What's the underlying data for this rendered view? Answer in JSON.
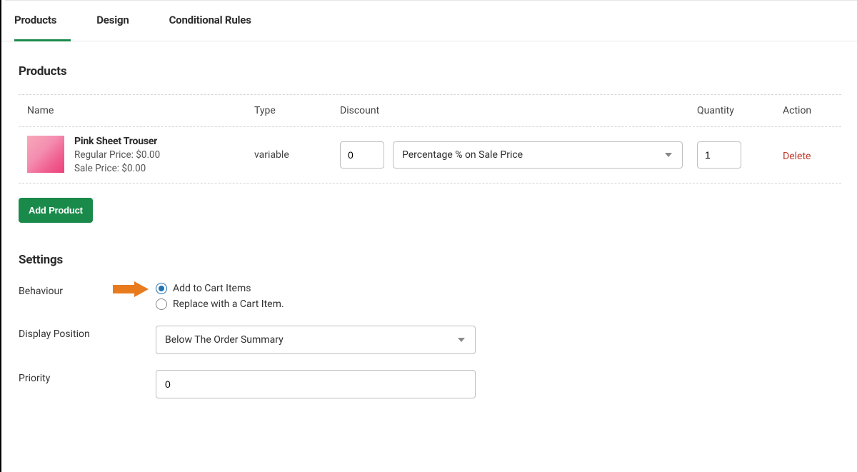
{
  "tabs": {
    "products": "Products",
    "design": "Design",
    "conditional_rules": "Conditional Rules"
  },
  "products_section": {
    "heading": "Products",
    "headers": {
      "name": "Name",
      "type": "Type",
      "discount": "Discount",
      "quantity": "Quantity",
      "action": "Action"
    },
    "rows": [
      {
        "title": "Pink Sheet Trouser",
        "regular_price_label": "Regular Price: $0.00",
        "sale_price_label": "Sale Price: $0.00",
        "type": "variable",
        "discount_amount": "0",
        "discount_type": "Percentage % on Sale Price",
        "quantity": "1",
        "delete_label": "Delete"
      }
    ],
    "add_button": "Add Product"
  },
  "settings": {
    "heading": "Settings",
    "behaviour": {
      "label": "Behaviour",
      "options": {
        "add": "Add to Cart Items",
        "replace": "Replace with a Cart Item."
      }
    },
    "display_position": {
      "label": "Display Position",
      "value": "Below The Order Summary"
    },
    "priority": {
      "label": "Priority",
      "value": "0"
    }
  }
}
